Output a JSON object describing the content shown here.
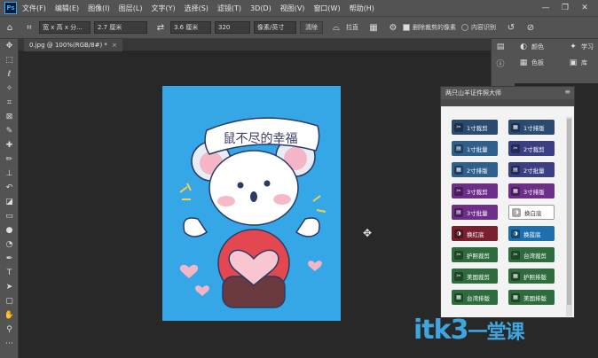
{
  "menubar": {
    "logo": "Ps",
    "items": [
      "文件(F)",
      "编辑(E)",
      "图像(I)",
      "图层(L)",
      "文字(Y)",
      "选择(S)",
      "滤镜(T)",
      "3D(D)",
      "视图(V)",
      "窗口(W)",
      "帮助(H)"
    ],
    "window_buttons": [
      "—",
      "❐",
      "✕"
    ]
  },
  "optionsbar": {
    "ratio_select": "宽 x 高 x 分...",
    "width_value": "2.7 厘米",
    "height_value": "3.6 厘米",
    "resolution_value": "320",
    "unit_select": "像素/英寸",
    "clear_button": "清除",
    "straighten_label": "拉直",
    "delete_cropped_label": "删除裁剪的像素",
    "content_aware_label": "内容识别"
  },
  "document": {
    "tab_label": "0.jpg @ 100%(RGB/8#) *",
    "banner_text": "鼠不尽的幸福"
  },
  "right_panels": {
    "color_label": "颜色",
    "swatches_label": "色板",
    "learn_label": "学习",
    "library_label": "库"
  },
  "plugin": {
    "title": "两只山羊证件照大师",
    "buttons": [
      {
        "label": "1寸裁剪",
        "color": "#2b4a6f"
      },
      {
        "label": "1寸排版",
        "color": "#2b4a6f"
      },
      {
        "label": "1寸批量",
        "color": "#2f5f8c"
      },
      {
        "label": "2寸裁剪",
        "color": "#3a3f84"
      },
      {
        "label": "2寸排版",
        "color": "#2f5f8c"
      },
      {
        "label": "2寸批量",
        "color": "#3a3f84"
      },
      {
        "label": "3寸裁剪",
        "color": "#6d2e8a"
      },
      {
        "label": "3寸排版",
        "color": "#6d2e8a"
      },
      {
        "label": "3寸批量",
        "color": "#6d2e8a"
      },
      {
        "label": "换白底",
        "color": "#ffffff"
      },
      {
        "label": "换红底",
        "color": "#7a1f2e"
      },
      {
        "label": "换蓝底",
        "color": "#1f6fb0"
      },
      {
        "label": "护照裁剪",
        "color": "#2e6b3d"
      },
      {
        "label": "台湾裁剪",
        "color": "#2e6b3d"
      },
      {
        "label": "美国裁剪",
        "color": "#2e6b3d"
      },
      {
        "label": "护照排版",
        "color": "#2e6b3d"
      },
      {
        "label": "台湾排版",
        "color": "#2e6b3d"
      },
      {
        "label": "美国排版",
        "color": "#2e6b3d"
      }
    ]
  },
  "watermark": {
    "main": "itk3",
    "sub": "一堂课"
  }
}
